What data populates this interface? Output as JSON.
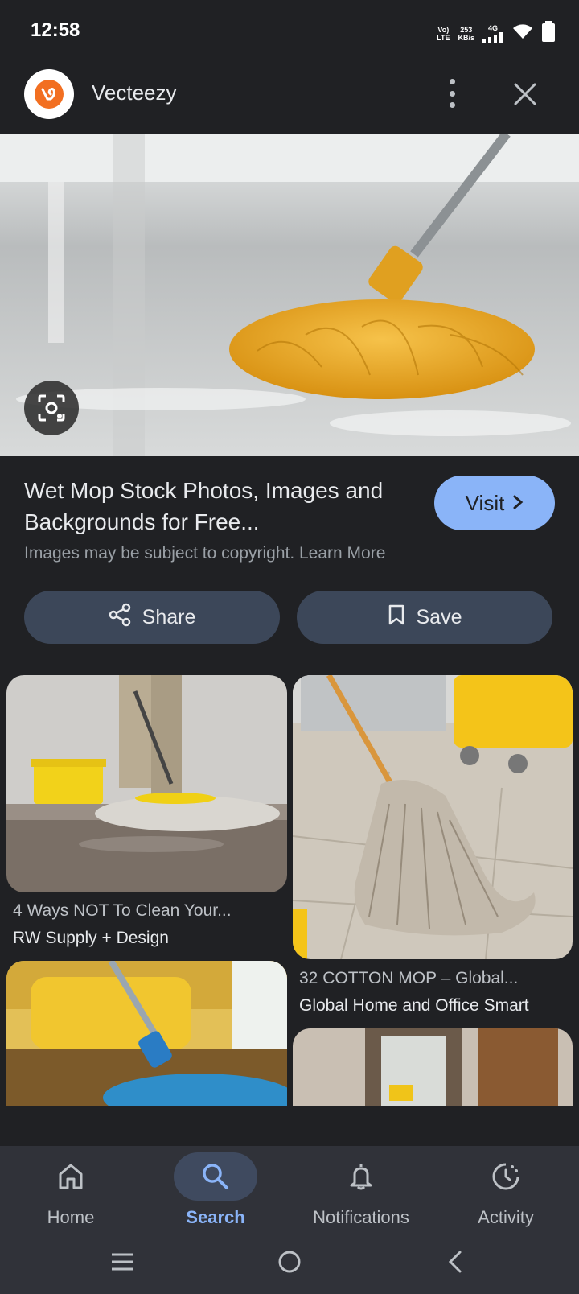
{
  "status_bar": {
    "time": "12:58",
    "volte": "Vo)",
    "lte": "LTE",
    "speed": "253",
    "speed_unit": "KB/s",
    "network": "4G",
    "icons": [
      "signal-icon",
      "wifi-icon",
      "battery-icon"
    ]
  },
  "header": {
    "site_name": "Vecteezy",
    "icons": [
      "vecteezy-logo",
      "more-vert-icon",
      "close-icon"
    ]
  },
  "result": {
    "title": "Wet Mop Stock Photos, Images and Backgrounds for Free...",
    "visit_label": "Visit",
    "copyright": "Images may be subject to copyright. Learn More"
  },
  "actions": {
    "share_label": "Share",
    "save_label": "Save"
  },
  "related": [
    {
      "title": "4 Ways NOT To Clean Your...",
      "source": "RW Supply + Design"
    },
    {
      "title": "32 COTTON MOP – Global...",
      "source": "Global Home and Office Smart"
    },
    {
      "title": "",
      "source": ""
    },
    {
      "title": "",
      "source": ""
    }
  ],
  "bottom_nav": {
    "items": [
      {
        "label": "Home",
        "icon": "home-icon"
      },
      {
        "label": "Search",
        "icon": "search-icon",
        "active": true
      },
      {
        "label": "Notifications",
        "icon": "bell-icon"
      },
      {
        "label": "Activity",
        "icon": "activity-icon"
      }
    ]
  },
  "colors": {
    "background": "#202124",
    "accent": "#8ab4f8",
    "button": "#3c4759",
    "nav_bg": "#303239",
    "mop_yellow": "#f0b52a"
  }
}
